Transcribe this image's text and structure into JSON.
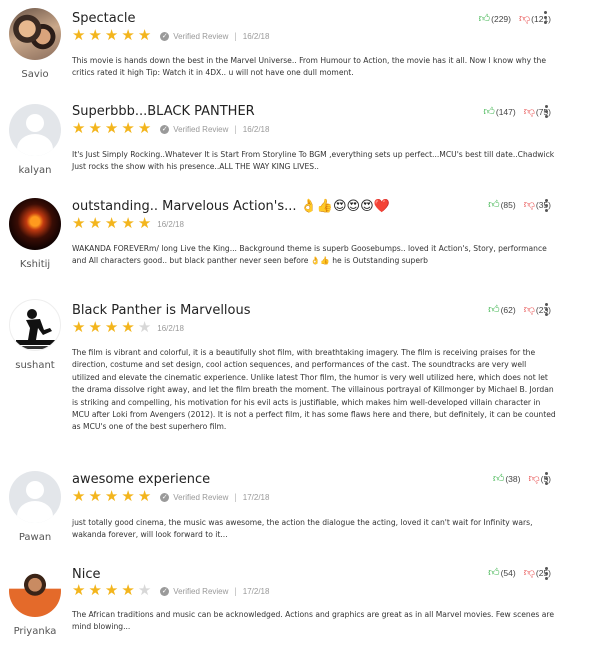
{
  "verified_label": "Verified Review",
  "reviews": [
    {
      "username": "Savio",
      "title": "Spectacle",
      "rating": 5,
      "verified": true,
      "date": "16/2/18",
      "up": "(229)",
      "down": "(121)",
      "text": "This movie is hands down the best in the Marvel Universe.. From Humour to Action, the movie has it all. Now I know why the critics rated it high Tip: Watch it in 4DX.. u will not have one dull moment."
    },
    {
      "username": "kalyan",
      "title": "Superbbb...BLACK PANTHER",
      "rating": 5,
      "verified": true,
      "date": "16/2/18",
      "up": "(147)",
      "down": "(75)",
      "text": "It's Just Simply Rocking..Whatever It is Start From Storyline To BGM ,everything sets up perfect...MCU's best till date..Chadwick Just rocks the show with his presence..ALL THE WAY KING LIVES.."
    },
    {
      "username": "Kshitij",
      "title": "outstanding.. Marvelous Action's... 👌👍😍😍😍❤️",
      "rating": 5,
      "verified": false,
      "date": "16/2/18",
      "up": "(85)",
      "down": "(35)",
      "text": "WAKANDA FOREVERm/ long Live the King... Background theme is superb Goosebumps.. loved it Action's, Story, performance and All characters good.. but black panther never seen before 👌👍 he is Outstanding superb"
    },
    {
      "username": "sushant",
      "title": "Black Panther is Marvellous",
      "rating": 4,
      "verified": false,
      "date": "16/2/18",
      "up": "(62)",
      "down": "(23)",
      "text": "The film is vibrant and colorful, it is a beautifully shot film, with breathtaking imagery. The film is receiving praises for the direction, costume and set design, cool action sequences, and performances of the cast. The soundtracks are very well utilized and elevate the cinematic experience. Unlike latest Thor film, the humor is very well utilized here, which does not let the drama dissolve right away, and let the film breath the moment. The villainous portrayal of Killmonger by Michael B. Jordan is striking and compelling, his motivation for his evil acts is justifiable, which makes him well-developed villain character in MCU after Loki from Avengers (2012). It is not a perfect film, it has some flaws here and there, but definitely, it can be counted as MCU's one of the best superhero film."
    },
    {
      "username": "Pawan",
      "title": "awesome experience",
      "rating": 5,
      "verified": true,
      "date": "17/2/18",
      "up": "(38)",
      "down": "(5)",
      "text": "just totally good cinema, the music was awesome, the action the dialogue the acting, loved it can't wait for Infinity wars, wakanda forever, will look forward to it..."
    },
    {
      "username": "Priyanka",
      "title": "Nice",
      "rating": 4,
      "verified": true,
      "date": "17/2/18",
      "up": "(54)",
      "down": "(25)",
      "text": "The African traditions and music can be acknowledged. Actions and graphics are great as in all Marvel movies. Few scenes are mind blowing..."
    }
  ],
  "colors": {
    "star_on": "#f3b51d",
    "star_off": "#d8d8d8",
    "thumb_up": "#3cb34c",
    "thumb_down": "#e74c4c"
  },
  "icons": {
    "thumb_up": "thumbs-up-icon",
    "thumb_down": "thumbs-down-icon",
    "verified": "check-circle-icon",
    "more": "kebab-menu-icon",
    "star": "star-icon"
  }
}
